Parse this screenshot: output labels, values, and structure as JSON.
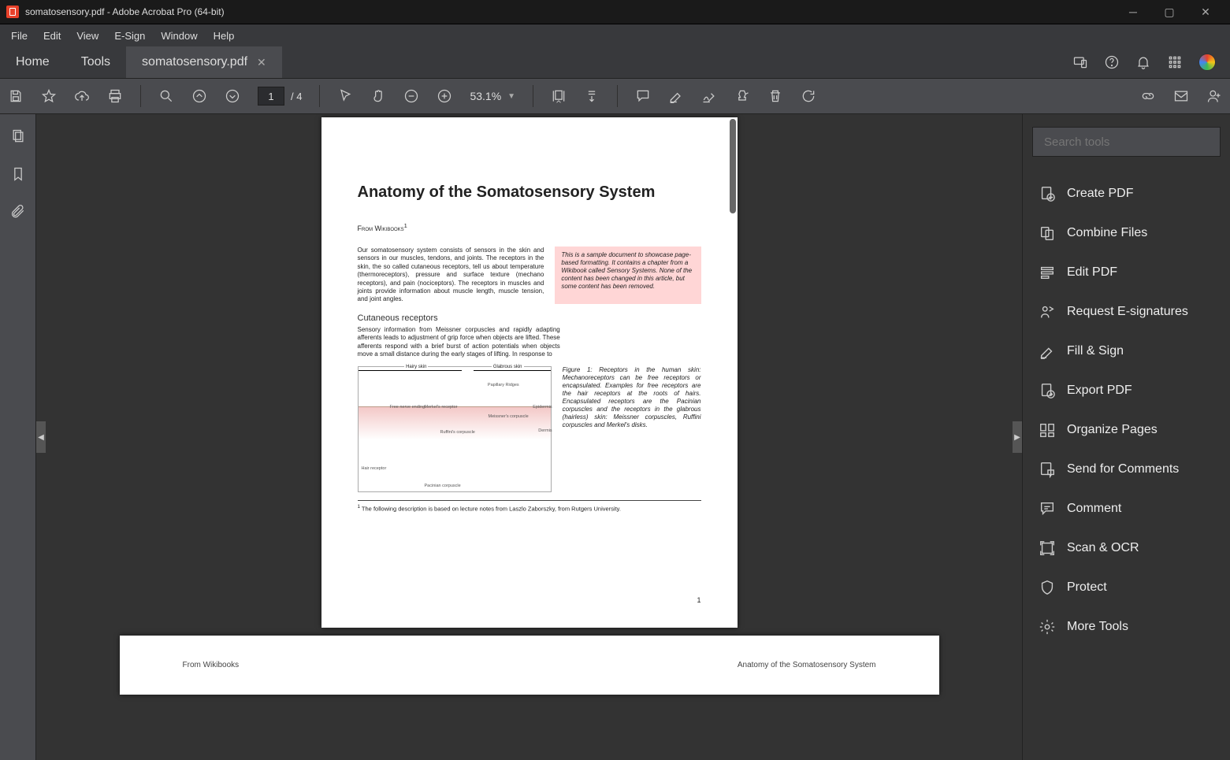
{
  "titlebar": {
    "title": "somatosensory.pdf - Adobe Acrobat Pro (64-bit)"
  },
  "menubar": [
    "File",
    "Edit",
    "View",
    "E-Sign",
    "Window",
    "Help"
  ],
  "tabs": {
    "home": "Home",
    "tools": "Tools",
    "doc": "somatosensory.pdf"
  },
  "toolbar": {
    "page_current": "1",
    "page_total": "/ 4",
    "zoom": "53.1%"
  },
  "rightrail": {
    "search_placeholder": "Search tools",
    "items": [
      {
        "label": "Create PDF",
        "color": "#ff5c7a"
      },
      {
        "label": "Combine Files",
        "color": "#9a7cff"
      },
      {
        "label": "Edit PDF",
        "color": "#ff5c7a"
      },
      {
        "label": "Request E-signatures",
        "color": "#c86cff"
      },
      {
        "label": "Fill & Sign",
        "color": "#9a7cff"
      },
      {
        "label": "Export PDF",
        "color": "#3be0e0"
      },
      {
        "label": "Organize Pages",
        "color": "#c8e84a"
      },
      {
        "label": "Send for Comments",
        "color": "#ffd23e"
      },
      {
        "label": "Comment",
        "color": "#ffd23e"
      },
      {
        "label": "Scan & OCR",
        "color": "#5cff8f"
      },
      {
        "label": "Protect",
        "color": "#7ab8ff"
      },
      {
        "label": "More Tools",
        "color": "#bbb"
      }
    ]
  },
  "doc": {
    "title": "Anatomy of the Somatosensory System",
    "from": "From Wikibooks",
    "sup": "1",
    "intro": "Our somatosensory system consists of sensors in the skin and sensors in our muscles, tendons, and joints. The receptors in the skin, the so called cutaneous receptors, tell us about temperature (thermoreceptors), pressure and surface texture (mechano receptors), and pain (nociceptors). The receptors in muscles and joints provide information about muscle length, muscle tension, and joint angles.",
    "callout": "This is a sample document to showcase page-based formatting. It contains a chapter from a Wikibook called Sensory Systems. None of the content has been changed in this article, but some content has been removed.",
    "sub": "Cutaneous receptors",
    "para2": "Sensory information from Meissner corpuscles and rapidly adapting afferents leads to adjustment of grip force when objects are lifted. These afferents respond with a brief burst of action potentials when objects move a small distance during the early stages of lifting. In response to",
    "fig_labels": {
      "hairy": "Hairy skin",
      "glabrous": "Glabrous skin",
      "epidermis": "Epidermis",
      "dermis": "Dermis",
      "papillary": "Papillary Ridges",
      "merkel": "Merkel's receptor",
      "meissner": "Meissner's corpuscle",
      "free": "Free nerve ending",
      "ruffini": "Ruffini's corpuscle",
      "hair": "Hair receptor",
      "pacinian": "Pacinian corpuscle"
    },
    "figcap": "Figure 1:  Receptors in the human skin: Mechanoreceptors can be free receptors or encapsulated. Examples for free receptors are the hair receptors at the roots of hairs. Encapsulated receptors are the Pacinian corpuscles and the receptors in the glabrous (hairless) skin: Meissner corpuscles, Ruffini corpuscles and Merkel's disks.",
    "footnote_sup": "1",
    "footnote": " The following description is based on lecture notes from Laszlo Zaborszky, from Rutgers University.",
    "pagenum": "1",
    "p2_left": "From Wikibooks",
    "p2_right": "Anatomy of the Somatosensory System"
  }
}
